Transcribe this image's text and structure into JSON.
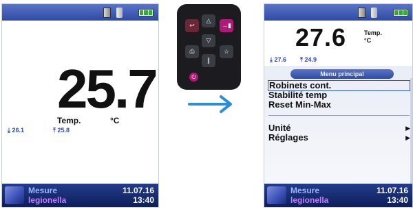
{
  "left_screen": {
    "value": "25.7",
    "parameter": "Temp.",
    "unit": "°C",
    "min": "26.1",
    "max": "25.8"
  },
  "right_screen": {
    "value": "27.6",
    "unit_line1": "Temp.",
    "unit_line2": "°C",
    "min": "27.6",
    "max": "24.9",
    "menu_title": "Menu principal",
    "menu_items": [
      "Robinets cont.",
      "Stabilité temp",
      "Reset Min-Max"
    ],
    "menu_submenus": [
      "Unité",
      "Réglages"
    ]
  },
  "status_bar": {
    "line1": "Mesure",
    "line2": "legionella",
    "date": "11.07.16",
    "time": "13:40"
  },
  "colors": {
    "accent_blue": "#2f4aa3",
    "magenta": "#b0197a",
    "arrow_blue": "#2a8fd8"
  }
}
